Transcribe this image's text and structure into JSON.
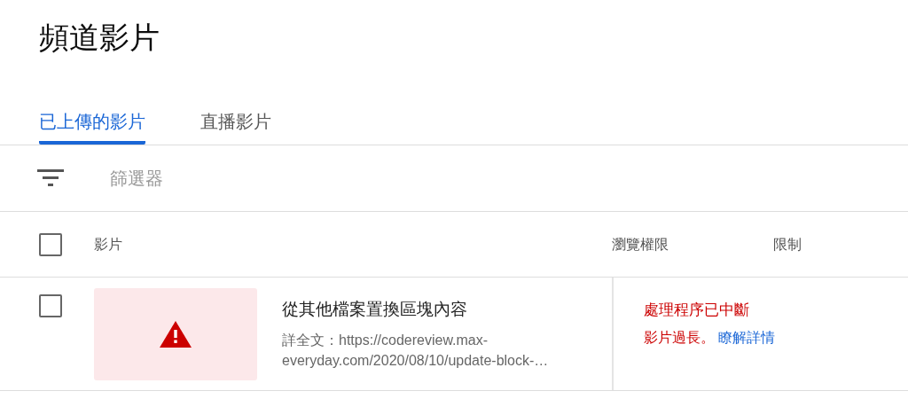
{
  "page": {
    "title": "頻道影片"
  },
  "tabs": [
    {
      "label": "已上傳的影片",
      "selected": true
    },
    {
      "label": "直播影片",
      "selected": false
    }
  ],
  "filter": {
    "placeholder": "篩選器"
  },
  "table": {
    "select_all": {
      "checked": false
    },
    "columns": [
      "影片",
      "瀏覽權限",
      "限制"
    ],
    "rows": [
      {
        "checked": false,
        "thumbnail": {
          "kind": "error"
        },
        "title": "從其他檔案置換區塊內容",
        "description_lines": [
          "詳全文：https://codereview.max-",
          "everyday.com/2020/08/10/update-block-…"
        ],
        "status": "處理程序已中斷",
        "status_detail": "影片過長。",
        "link": "瞭解詳情"
      }
    ]
  }
}
